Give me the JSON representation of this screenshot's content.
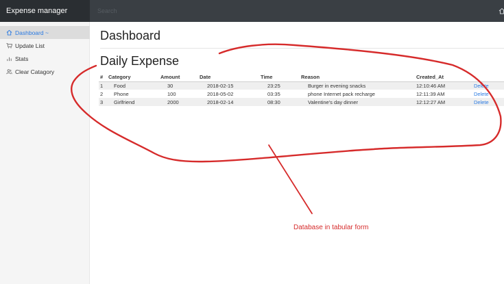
{
  "app": {
    "title": "Expense manager"
  },
  "search": {
    "placeholder": "Search"
  },
  "sidebar": {
    "items": [
      {
        "label": "Dashboard ~",
        "icon": "home-icon",
        "active": true
      },
      {
        "label": "Update List",
        "icon": "cart-icon",
        "active": false
      },
      {
        "label": "Stats",
        "icon": "bar-chart-icon",
        "active": false
      },
      {
        "label": "Clear Catagory",
        "icon": "users-icon",
        "active": false
      }
    ]
  },
  "main": {
    "title": "Dashboard",
    "section_title": "Daily Expense"
  },
  "table": {
    "headers": [
      "#",
      "Category",
      "Amount",
      "Date",
      "Time",
      "Reason",
      "Created_At",
      ""
    ],
    "rows": [
      {
        "num": "1",
        "category": "Food",
        "amount": "30",
        "date": "2018-02-15",
        "time": "23:25",
        "reason": "Burger in evening snacks",
        "created_at": "12:10:46 AM",
        "action": "Delete"
      },
      {
        "num": "2",
        "category": "Phone",
        "amount": "100",
        "date": "2018-05-02",
        "time": "03:35",
        "reason": "phone Internet pack recharge",
        "created_at": "12:11:39 AM",
        "action": "Delete"
      },
      {
        "num": "3",
        "category": "Girlfriend",
        "amount": "2000",
        "date": "2018-02-14",
        "time": "08:30",
        "reason": "Valentine's day dinner",
        "created_at": "12:12:27 AM",
        "action": "Delete"
      }
    ]
  },
  "annotation": {
    "label": "Database in tabular form",
    "color": "#d62b2b"
  },
  "colors": {
    "topbar": "#3a3f44",
    "brand_bg": "#2a2e32",
    "sidebar_bg": "#f5f5f5",
    "active_item_bg": "#dcdcdc",
    "link": "#2a7ae2"
  }
}
